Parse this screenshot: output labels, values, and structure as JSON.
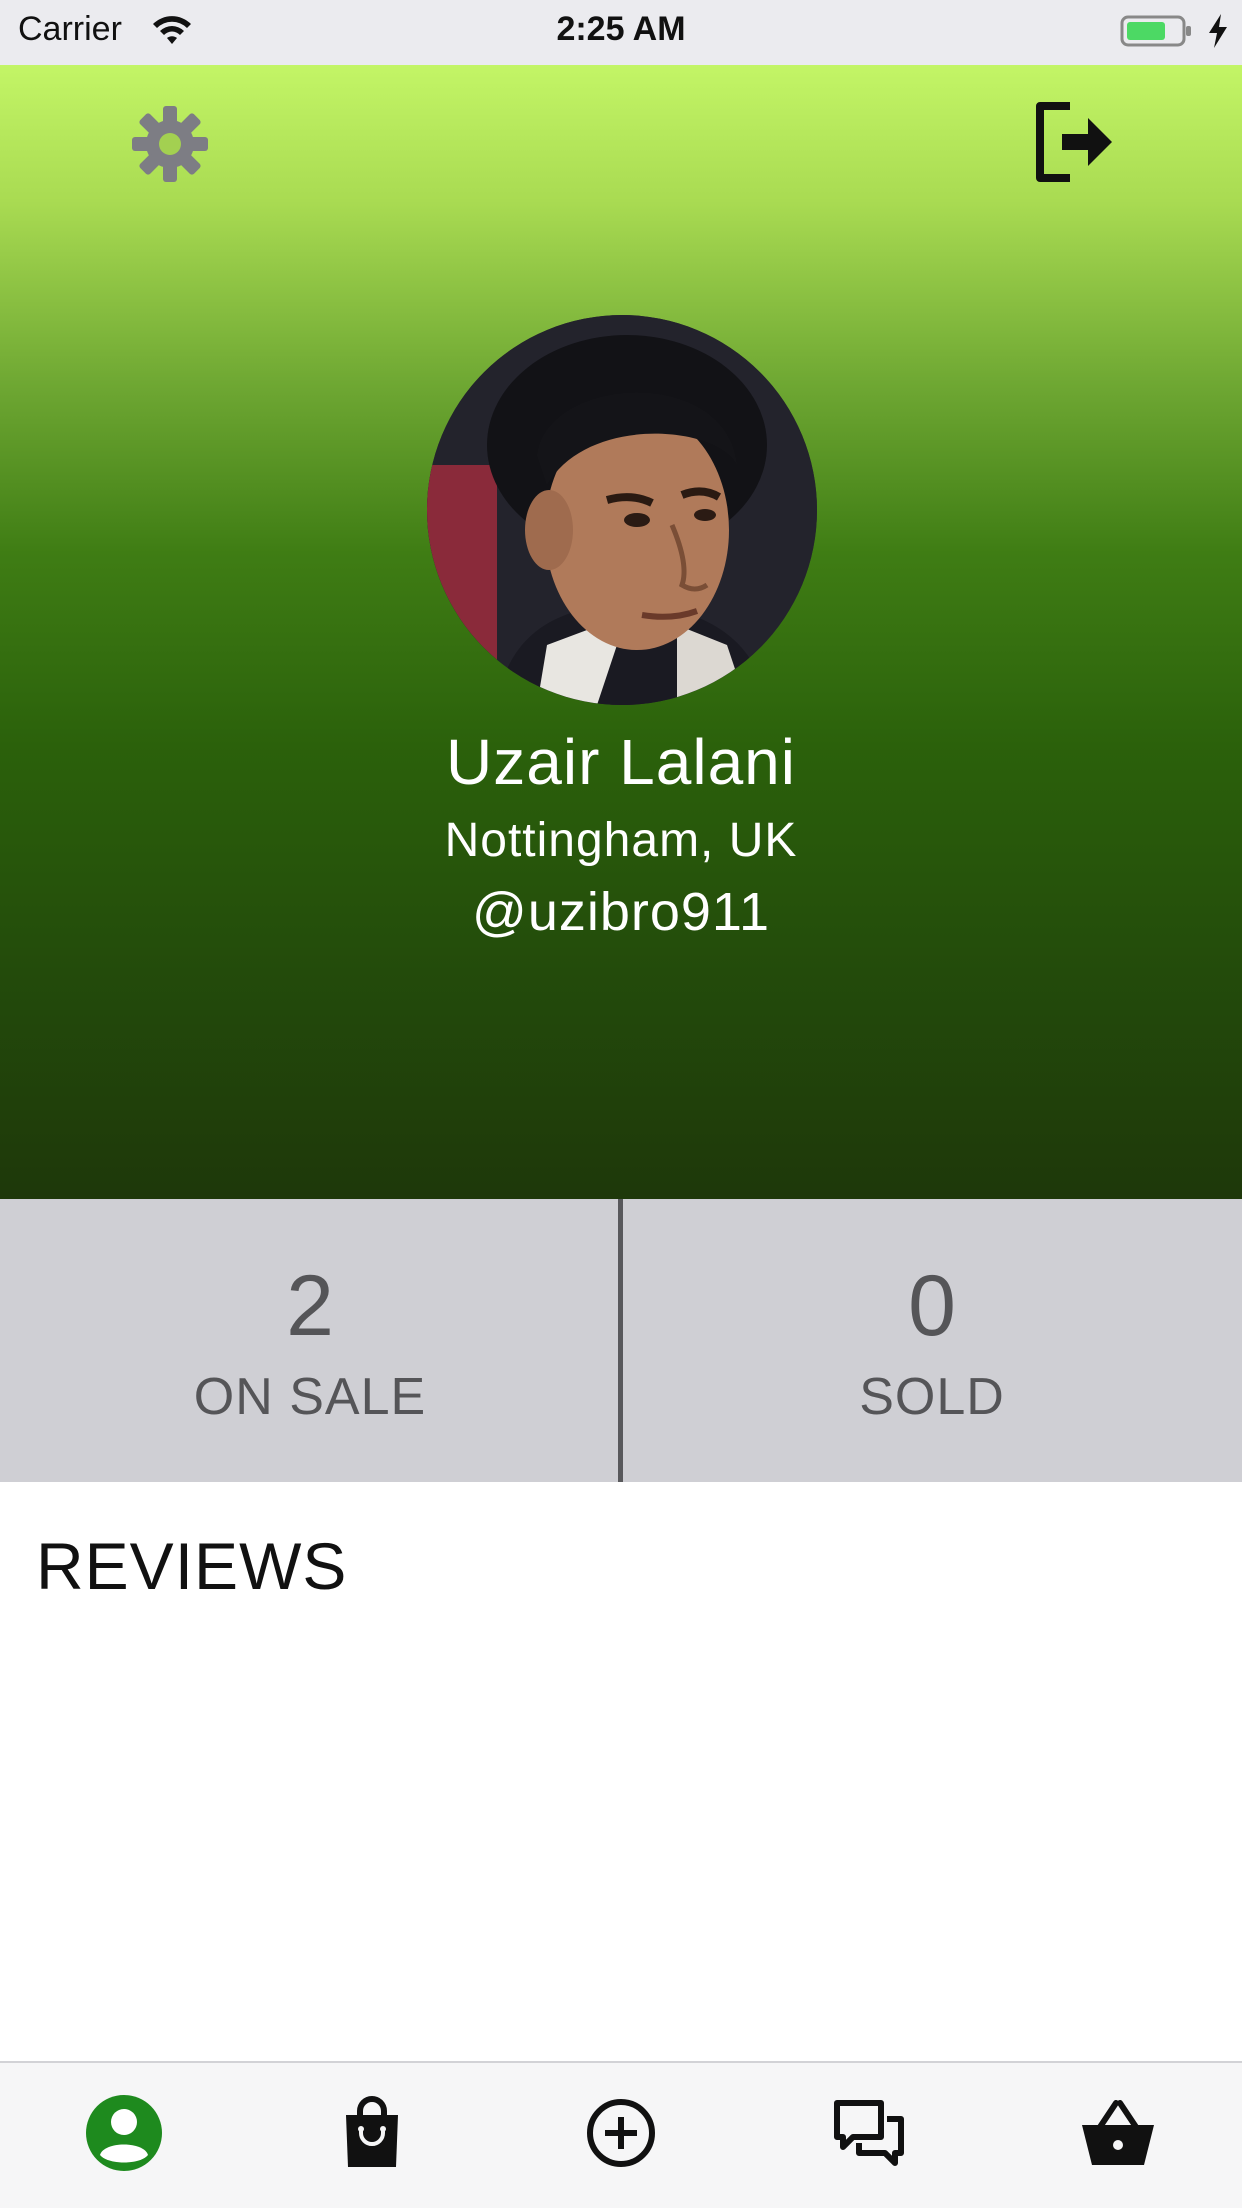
{
  "status_bar": {
    "carrier": "Carrier",
    "time": "2:25 AM",
    "wifi_icon": "wifi-icon",
    "battery_icon": "battery-icon",
    "charging_icon": "charging-bolt-icon"
  },
  "header": {
    "settings_icon": "gear-icon",
    "logout_icon": "logout-icon",
    "gradient_colors": [
      "#c3f566",
      "#3f7d14",
      "#1e380a"
    ]
  },
  "profile": {
    "name": "Uzair Lalani",
    "location": "Nottingham, UK",
    "handle": "@uzibro911"
  },
  "stats": {
    "on_sale": {
      "value": "2",
      "label": "ON SALE"
    },
    "sold": {
      "value": "0",
      "label": "SOLD"
    }
  },
  "reviews": {
    "title": "REVIEWS"
  },
  "tab_bar": {
    "active_color": "#1e8a1e",
    "items": [
      {
        "icon": "profile-icon",
        "active": true
      },
      {
        "icon": "shopping-bag-icon",
        "active": false
      },
      {
        "icon": "add-circle-icon",
        "active": false
      },
      {
        "icon": "chat-icon",
        "active": false
      },
      {
        "icon": "basket-icon",
        "active": false
      }
    ]
  }
}
